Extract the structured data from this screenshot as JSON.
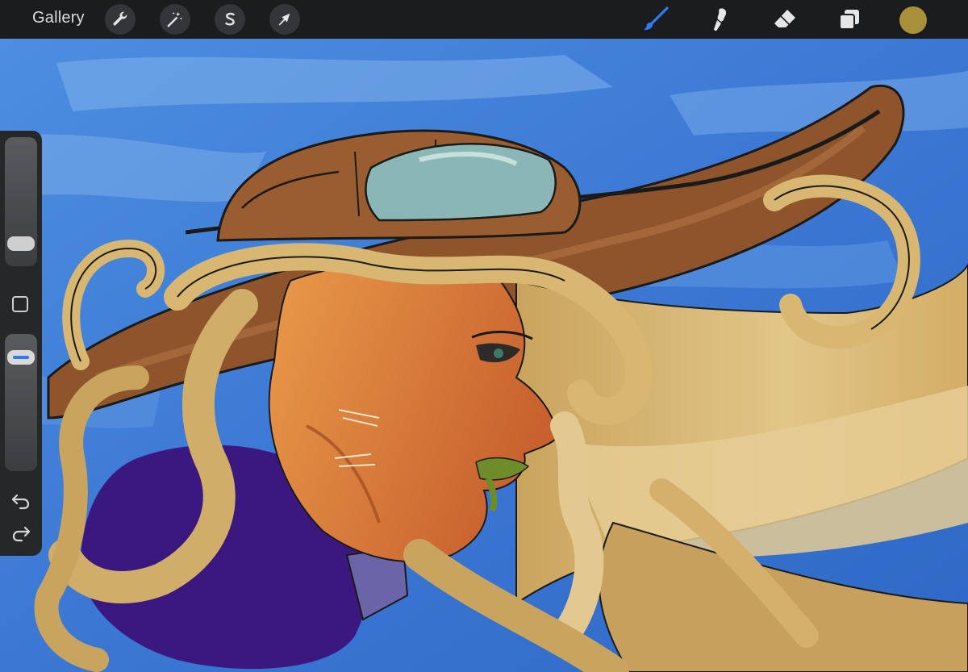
{
  "topbar": {
    "gallery_label": "Gallery",
    "left_tools": [
      {
        "name": "wrench-icon"
      },
      {
        "name": "magic-wand-icon"
      },
      {
        "name": "selection-s-icon"
      },
      {
        "name": "arrow-transform-icon"
      }
    ],
    "right_tools": [
      {
        "name": "brush-icon",
        "active": true
      },
      {
        "name": "smudge-icon"
      },
      {
        "name": "eraser-icon"
      },
      {
        "name": "layers-icon"
      }
    ],
    "current_color": "#a8903a",
    "active_tool_color": "#2f7cf0"
  },
  "sidebar": {
    "brush_size_level": 0.1,
    "opacity_level": 0.9,
    "icons": [
      "modify-square-icon",
      "undo-icon",
      "redo-icon"
    ]
  },
  "canvas": {
    "sky_color": "#3f7fd6",
    "hat_color": "#8e542c",
    "hair_color": "#d8b772",
    "skin_color": "#d97a3c",
    "coat_color": "#3a1880"
  }
}
